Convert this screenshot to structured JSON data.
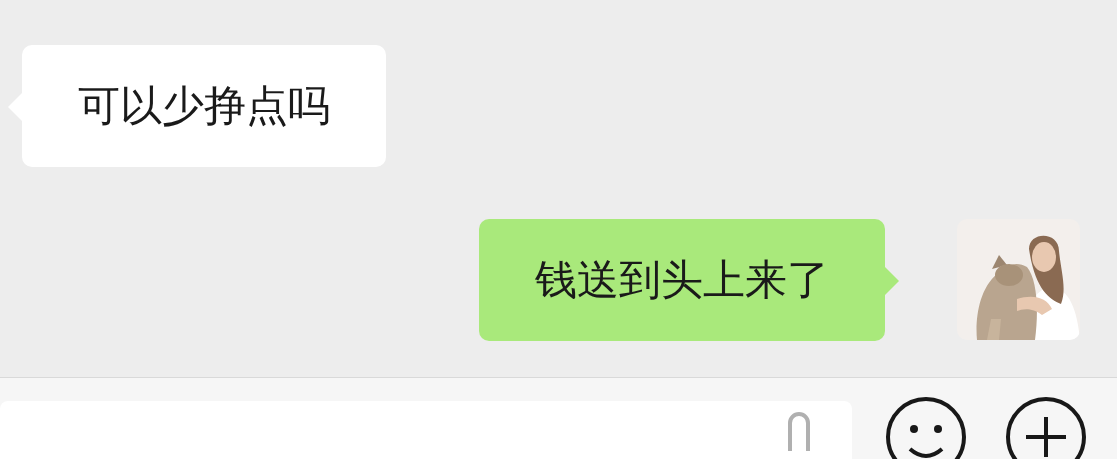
{
  "messages": [
    {
      "kind": "incoming",
      "text": "可以少挣点吗"
    },
    {
      "kind": "outgoing",
      "text": "钱送到头上来了"
    }
  ]
}
